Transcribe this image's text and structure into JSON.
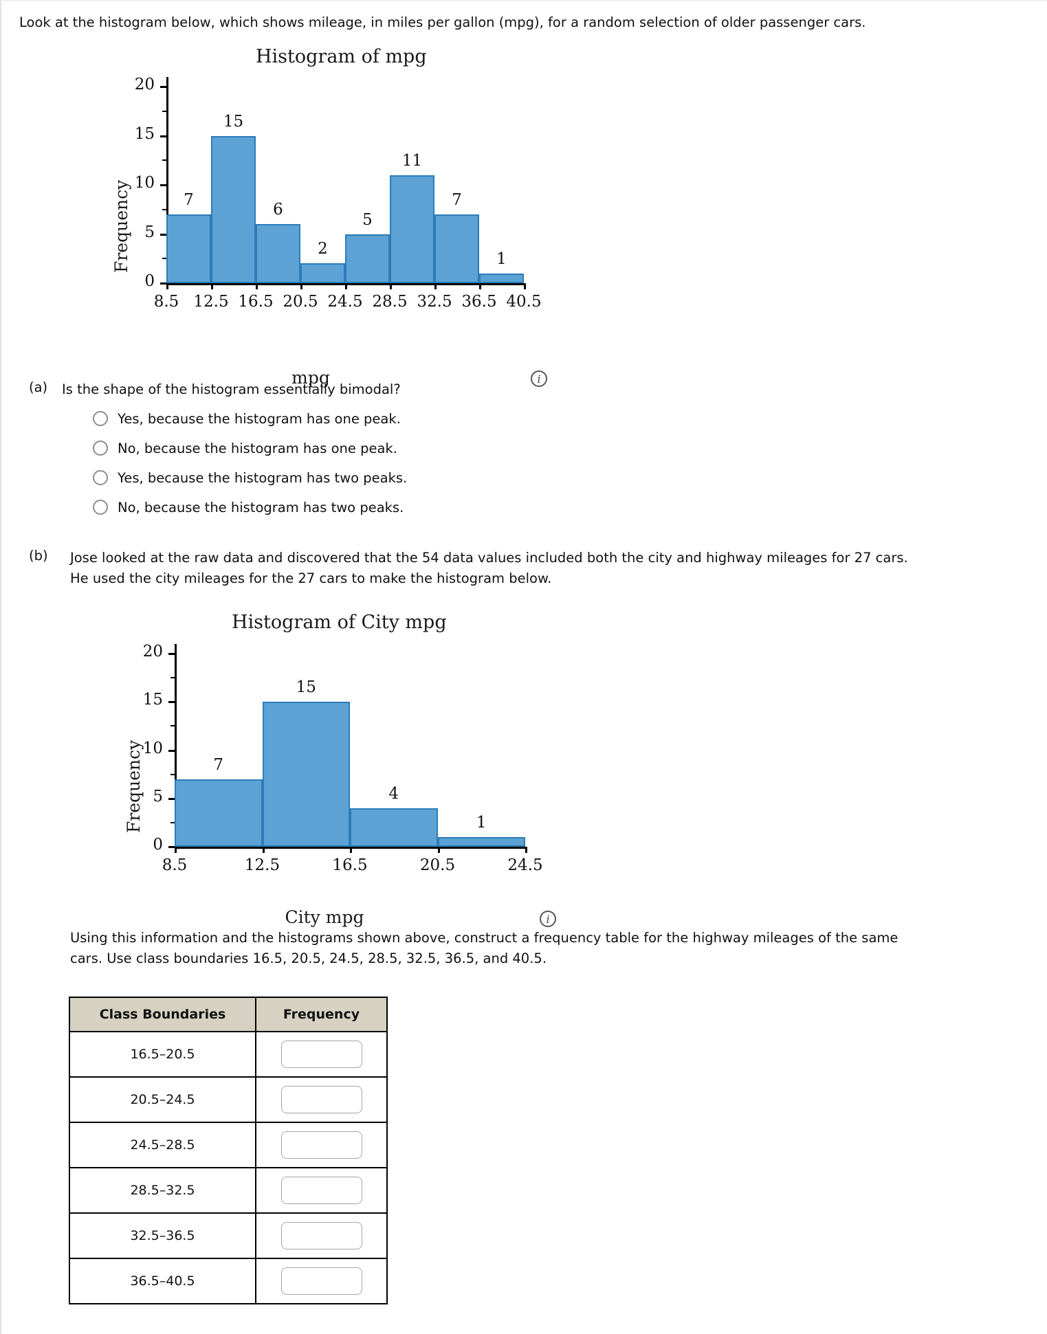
{
  "prompt": "Look at the histogram below, which shows mileage, in miles per gallon (mpg), for a random selection of older passenger cars.",
  "info_icon": "i",
  "chart_data": [
    {
      "type": "bar",
      "title": "Histogram of mpg",
      "xlabel": "mpg",
      "ylabel": "Frequency",
      "categories": [
        "8.5-12.5",
        "12.5-16.5",
        "16.5-20.5",
        "20.5-24.5",
        "24.5-28.5",
        "28.5-32.5",
        "32.5-36.5",
        "36.5-40.5"
      ],
      "bin_edges": [
        "8.5",
        "12.5",
        "16.5",
        "20.5",
        "24.5",
        "28.5",
        "32.5",
        "36.5",
        "40.5"
      ],
      "values": [
        7,
        15,
        6,
        2,
        5,
        11,
        7,
        1
      ],
      "bar_labels": [
        "7",
        "15",
        "6",
        "2",
        "5",
        "11",
        "7",
        "1"
      ],
      "ylim": [
        0,
        21
      ],
      "ytick_labels": [
        "0",
        "5",
        "10",
        "15",
        "20"
      ],
      "ytick_values": [
        0,
        5,
        10,
        15,
        20
      ],
      "grid": false,
      "legend": "none",
      "bar_color": "#5ca2d4",
      "bar_edge_color": "#2b7cb8"
    },
    {
      "type": "bar",
      "title": "Histogram of City mpg",
      "xlabel": "City mpg",
      "ylabel": "Frequency",
      "categories": [
        "8.5-12.5",
        "12.5-16.5",
        "16.5-20.5",
        "20.5-24.5"
      ],
      "bin_edges": [
        "8.5",
        "12.5",
        "16.5",
        "20.5",
        "24.5"
      ],
      "values": [
        7,
        15,
        4,
        1
      ],
      "bar_labels": [
        "7",
        "15",
        "4",
        "1"
      ],
      "ylim": [
        0,
        21
      ],
      "ytick_labels": [
        "0",
        "5",
        "10",
        "15",
        "20"
      ],
      "ytick_values": [
        0,
        5,
        10,
        15,
        20
      ],
      "grid": false,
      "legend": "none",
      "bar_color": "#5ca2d4",
      "bar_edge_color": "#2b7cb8"
    }
  ],
  "part_a": {
    "tag": "(a)",
    "question": "Is the shape of the histogram essentially bimodal?",
    "choices": [
      "Yes, because the histogram has one peak.",
      "No, because the histogram has one peak.",
      "Yes, because the histogram has two peaks.",
      "No, because the histogram has two peaks."
    ]
  },
  "part_b": {
    "tag": "(b)",
    "line1": "Jose looked at the raw data and discovered that the 54 data values included both the city and highway mileages for 27 cars.",
    "line2": "He used the city mileages for the 27 cars to make the histogram below.",
    "instruction_line1": "Using this information and the histograms shown above, construct a frequency table for the highway mileages of the same",
    "instruction_line2": "cars. Use class boundaries 16.5, 20.5, 24.5, 28.5, 32.5, 36.5, and 40.5."
  },
  "table": {
    "headers": [
      "Class Boundaries",
      "Frequency"
    ],
    "rows": [
      {
        "bounds": "16.5–20.5",
        "frequency": ""
      },
      {
        "bounds": "20.5–24.5",
        "frequency": ""
      },
      {
        "bounds": "24.5–28.5",
        "frequency": ""
      },
      {
        "bounds": "28.5–32.5",
        "frequency": ""
      },
      {
        "bounds": "32.5–36.5",
        "frequency": ""
      },
      {
        "bounds": "36.5–40.5",
        "frequency": ""
      }
    ]
  }
}
